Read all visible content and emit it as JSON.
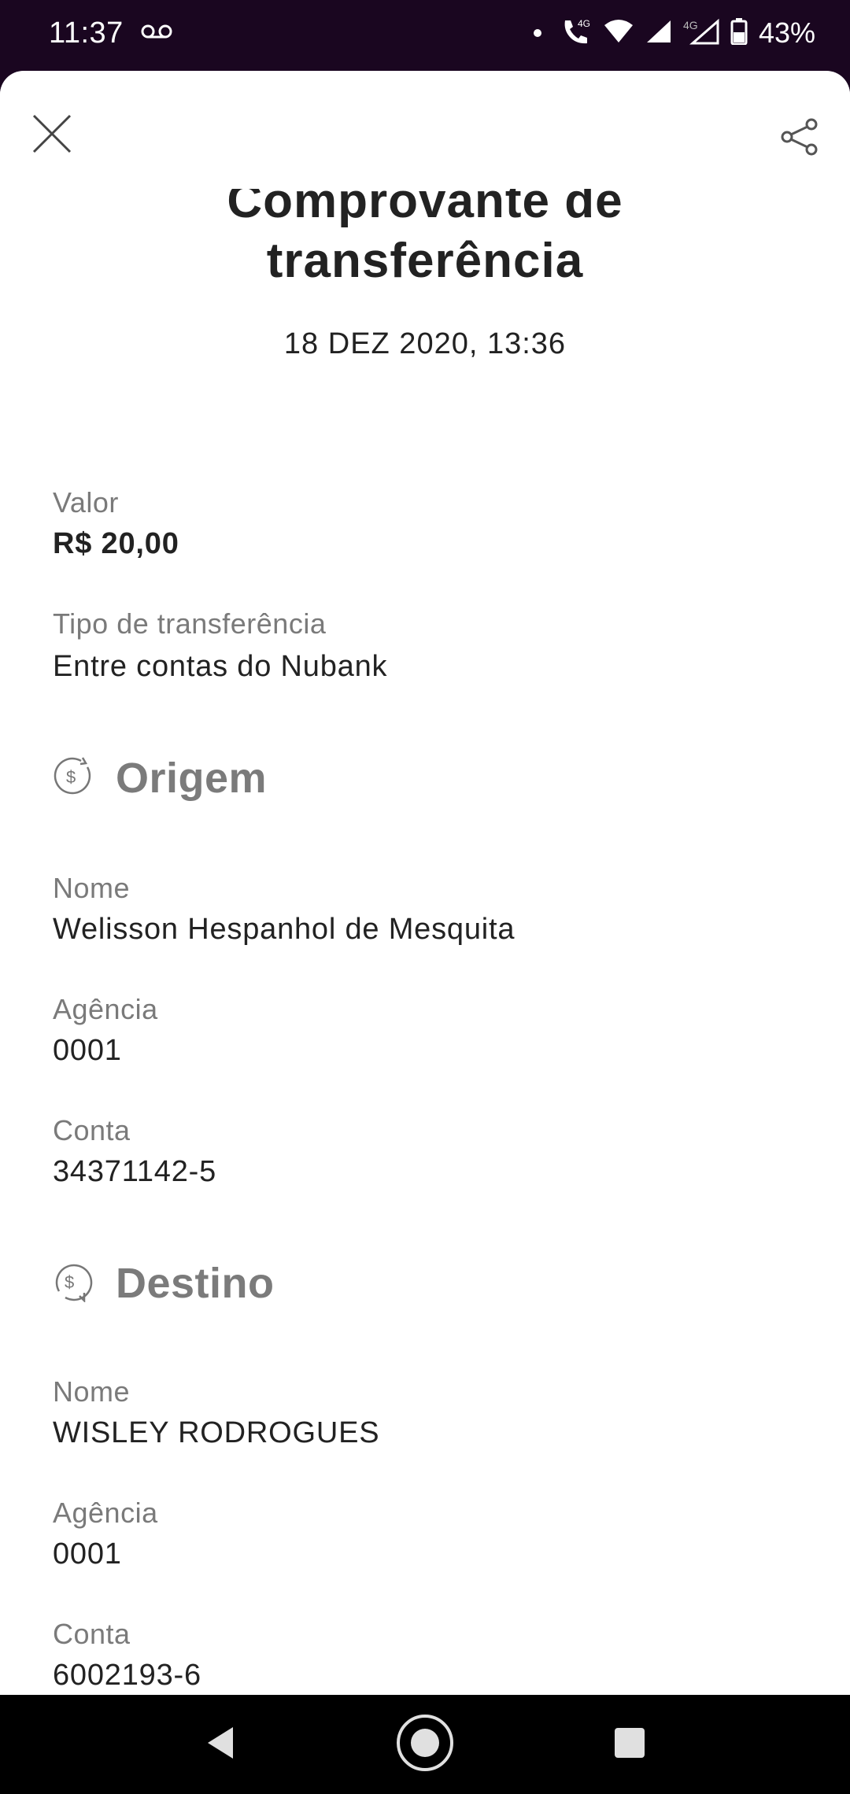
{
  "status_bar": {
    "time": "11:37",
    "battery": "43%",
    "network_label_1": "4G",
    "network_label_2": "4G"
  },
  "header": {
    "title": "Comprovante de transferência",
    "date": "18 DEZ 2020, 13:36"
  },
  "transfer": {
    "valor_label": "Valor",
    "valor_value": "R$ 20,00",
    "tipo_label": "Tipo de transferência",
    "tipo_value": "Entre contas do Nubank"
  },
  "origem": {
    "title": "Origem",
    "nome_label": "Nome",
    "nome_value": "Welisson Hespanhol de Mesquita",
    "agencia_label": "Agência",
    "agencia_value": "0001",
    "conta_label": "Conta",
    "conta_value": "34371142-5"
  },
  "destino": {
    "title": "Destino",
    "nome_label": "Nome",
    "nome_value": "WISLEY RODROGUES",
    "agencia_label": "Agência",
    "agencia_value": "0001",
    "conta_label": "Conta",
    "conta_value": "6002193-6"
  },
  "icons": {
    "close": "close-icon",
    "share": "share-icon",
    "origem": "money-out-icon",
    "destino": "money-in-icon"
  }
}
